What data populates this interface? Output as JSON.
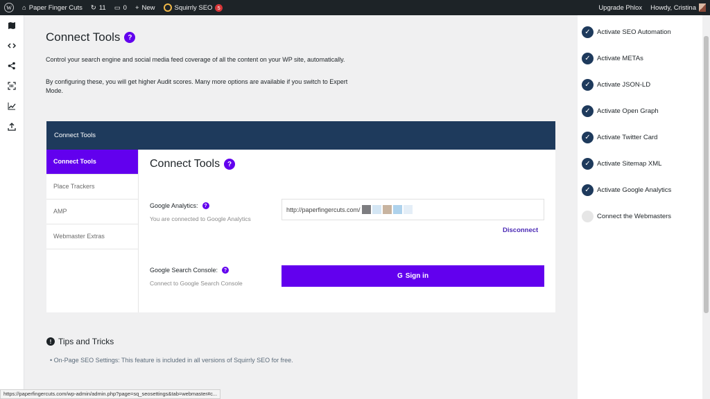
{
  "adminbar": {
    "site_name": "Paper Finger Cuts",
    "updates_count": "11",
    "comments_count": "0",
    "new_label": "New",
    "plugin_label": "Squirrly SEO",
    "plugin_badge": "5",
    "upgrade_label": "Upgrade Phlox",
    "howdy_label": "Howdy, Cristina"
  },
  "page": {
    "title": "Connect Tools",
    "help": "?",
    "intro1": "Control your search engine and social media feed coverage of all the content on your WP site, automatically.",
    "intro2": "By configuring these, you will get higher Audit scores. Many more options are available if you switch to Expert Mode."
  },
  "card": {
    "header": "Connect Tools",
    "tabs": [
      {
        "label": "Connect Tools"
      },
      {
        "label": "Place Trackers"
      },
      {
        "label": "AMP"
      },
      {
        "label": "Webmaster Extras"
      }
    ],
    "content_title": "Connect Tools",
    "analytics": {
      "label": "Google Analytics:",
      "sub": "You are connected to Google Analytics",
      "url_value": "http://paperfingercuts.com/",
      "disconnect": "Disconnect"
    },
    "console": {
      "label": "Google Search Console:",
      "sub": "Connect to Google Search Console",
      "signin": "Sign in",
      "signin_icon": "G"
    }
  },
  "tips": {
    "title": "Tips and Tricks",
    "icon": "!",
    "item": "On-Page SEO Settings: This feature is included in all versions of Squirrly SEO for free."
  },
  "tasks": [
    {
      "label": "Activate SEO Automation",
      "done": true
    },
    {
      "label": "Activate METAs",
      "done": true
    },
    {
      "label": "Activate JSON-LD",
      "done": true
    },
    {
      "label": "Activate Open Graph",
      "done": true
    },
    {
      "label": "Activate Twitter Card",
      "done": true
    },
    {
      "label": "Activate Sitemap XML",
      "done": true
    },
    {
      "label": "Activate Google Analytics",
      "done": true
    },
    {
      "label": "Connect the Webmasters",
      "done": false
    }
  ],
  "statusbar": "https://paperfingercuts.com/wp-admin/admin.php?page=sq_seosettings&tab=webmaster#c...",
  "colors": {
    "accent": "#6200ee",
    "navy": "#1e3a5c",
    "adminbar": "#1d2327"
  }
}
